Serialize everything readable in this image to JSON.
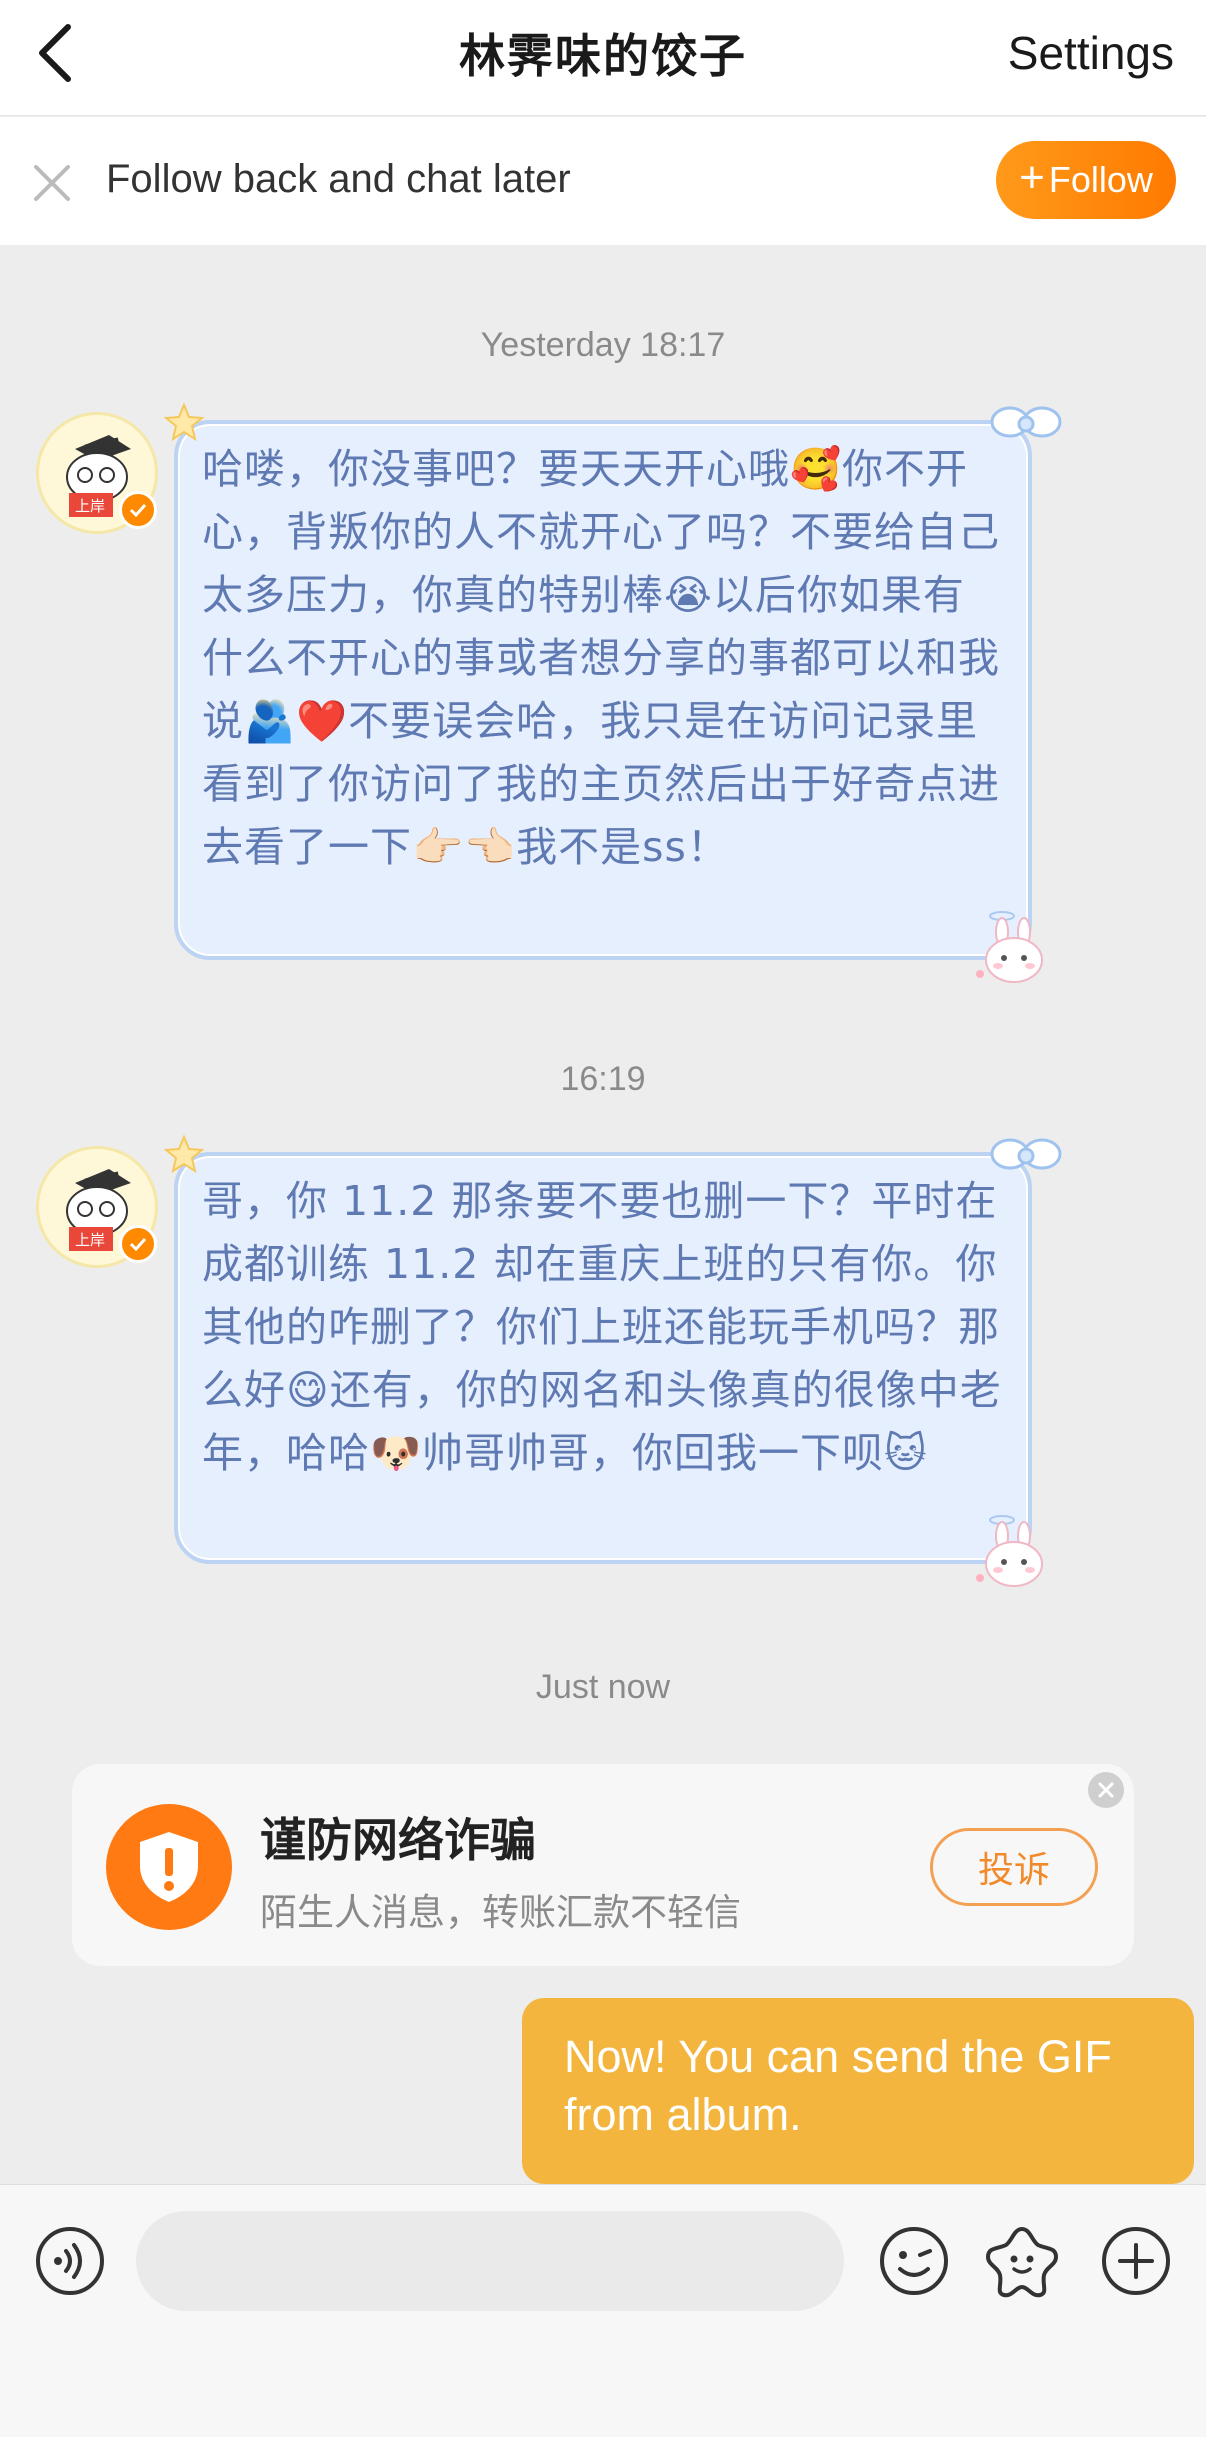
{
  "header": {
    "title": "林霁味的饺子",
    "settings_label": "Settings"
  },
  "follow_bar": {
    "text": "Follow back and chat later",
    "button_label": "Follow",
    "button_plus": "+"
  },
  "conversation": {
    "timestamps": [
      "Yesterday 18:17",
      "16:19",
      "Just now"
    ],
    "messages": [
      {
        "text": "哈喽，你没事吧？要天天开心哦🥰你不开心，背叛你的人不就开心了吗？不要给自己太多压力，你真的特别棒😭以后你如果有什么不开心的事或者想分享的事都可以和我说🫂❤️不要误会哈，我只是在访问记录里看到了你访问了我的主页然后出于好奇点进去看了一下👉🏻👈🏻我不是ss！"
      },
      {
        "text": "哥，你 11.2 那条要不要也删一下？平时在成都训练 11.2 却在重庆上班的只有你。你其他的咋删了？你们上班还能玩手机吗？那么好😋还有，你的网名和头像真的很像中老年，哈哈🐶帅哥帅哥，你回我一下呗🐱"
      }
    ]
  },
  "warning": {
    "title": "谨防网络诈骗",
    "subtitle": "陌生人消息，转账汇款不轻信",
    "report_label": "投诉"
  },
  "tooltip": {
    "text": "Now! You can send the GIF from album."
  },
  "input_bar": {
    "placeholder": ""
  },
  "colors": {
    "accent": "#ff8a00",
    "bubble_bg": "#e6effd",
    "bubble_text": "#5f79b2",
    "tooltip_bg": "#f3b53d"
  }
}
